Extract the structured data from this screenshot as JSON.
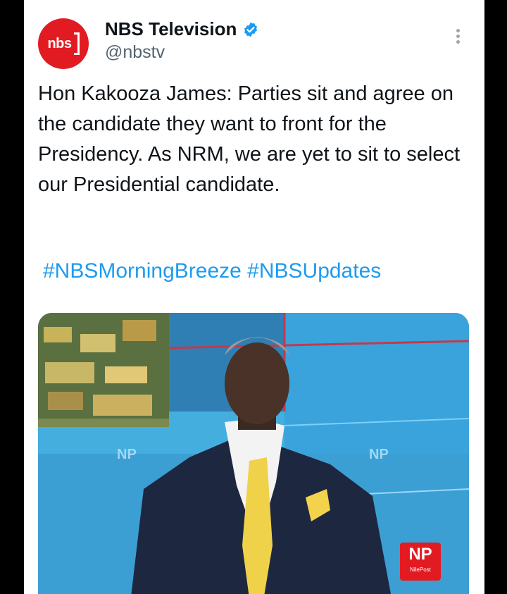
{
  "tweet": {
    "avatar_text": "nbs",
    "display_name": "NBS Television",
    "handle": "@nbstv",
    "text": "Hon Kakooza James: Parties sit and agree on the candidate they want to front for the Presidency. As NRM, we are yet to sit to select our Presidential candidate.",
    "hashtags": [
      "#NBSMorningBreeze",
      "#NBSUpdates"
    ]
  },
  "media": {
    "badge_main": "NP",
    "badge_sub": "NilePost"
  },
  "colors": {
    "avatar_bg": "#e21b22",
    "verified": "#1d9bf0",
    "hashtag": "#1d9bf0",
    "text": "#0f1419",
    "handle": "#536471"
  },
  "icons": {
    "verified": "verified-badge-icon",
    "more": "more-options-icon"
  }
}
